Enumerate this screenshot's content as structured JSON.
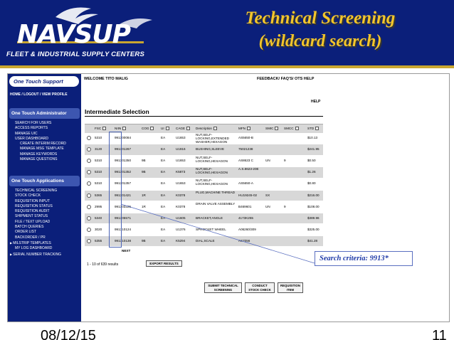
{
  "header": {
    "logo": "NAVSUP",
    "org": "FLEET & INDUSTRIAL SUPPLY CENTERS",
    "title_line1": "Technical Screening",
    "title_line2": "(wildcard search)",
    "colors": {
      "banner": "#0b1f7a",
      "title": "#f3c52a",
      "stripe": "#c9a630"
    }
  },
  "nav": {
    "brand": "One Touch Support",
    "home_links": "HOME / LOGOUT / VIEW PROFILE",
    "admin_title": "One Touch Administrator",
    "admin_items": [
      {
        "label": "SEARCH FOR USERS",
        "sub": false
      },
      {
        "label": "ACCESS REPORTS",
        "sub": false
      },
      {
        "label": "MANAGE UIC",
        "sub": false
      },
      {
        "label": "USER DASHBOARD",
        "sub": false
      },
      {
        "label": "CREATE INTERIM RECORD",
        "sub": true
      },
      {
        "label": "MANAGE MSG TEMPLATE",
        "sub": true
      },
      {
        "label": "MANAGE KEYWORDS",
        "sub": true
      },
      {
        "label": "MANAGE QUESTIONS",
        "sub": true
      }
    ],
    "apps_title": "One Touch Applications",
    "app_items": [
      {
        "label": "TECHNICAL SCREENING",
        "arrow": false
      },
      {
        "label": "STOCK CHECK",
        "arrow": false
      },
      {
        "label": "REQUISITION INPUT",
        "arrow": false
      },
      {
        "label": "REQUISITION STATUS",
        "arrow": false
      },
      {
        "label": "REQUISITION AUDIT",
        "arrow": false
      },
      {
        "label": "SHIPMENT STATUS",
        "arrow": false
      },
      {
        "label": "FILE / TEXT UPLOAD",
        "arrow": false
      },
      {
        "label": "BATCH QUERIES",
        "arrow": false
      },
      {
        "label": "ORDER LIST",
        "arrow": false
      },
      {
        "label": "BACKORDER / PR",
        "arrow": false
      },
      {
        "label": "MILSTRIP TEMPLATES",
        "arrow": true
      },
      {
        "label": "MY LOG DASHBOARD",
        "arrow": false
      },
      {
        "label": "SERIAL NUMBER TRACKING",
        "arrow": true
      }
    ]
  },
  "main": {
    "welcome": "WELCOME TITO MALIG",
    "feedback": "FEEDBACK/ FAQ'S/ OTS HELP",
    "help": "HELP",
    "section_title": "Intermediate Selection",
    "columns": [
      "FSC",
      "NIIN",
      "COG",
      "UI",
      "CAGE",
      "Description",
      "MFN",
      "SMIC",
      "SMCC",
      "STD"
    ],
    "rows": [
      [
        "5310",
        "991300084",
        "",
        "EA",
        "U1653",
        "NUT,SELF-LOCKING,EXTENDED WASHER,HEXAGON",
        "AS5650-B",
        "",
        "",
        "$10.13"
      ],
      [
        "3120",
        "991301267",
        "",
        "EA",
        "U1916",
        "BUSHING,SLEEVE",
        "75021238",
        "",
        "",
        "$241.95"
      ],
      [
        "5310",
        "991301350",
        "9B",
        "EA",
        "U1653",
        "NUT,SELF-LOCKING,HEXAGON",
        "AS8623 C",
        "UN",
        "9",
        "$0.50"
      ],
      [
        "5310",
        "991301352",
        "9B",
        "EA",
        "K5873",
        "NUT,SELF-LOCKING,HEXAGON",
        "A.S.8623-20E",
        "",
        "",
        "$1.26"
      ],
      [
        "5310",
        "991301357",
        "",
        "EA",
        "U1653",
        "NUT,SELF-LOCKING,HEXAGON",
        "AS5650-A",
        "",
        "",
        "$0.80"
      ],
      [
        "5365",
        "991301421",
        "1R",
        "EA",
        "K0378",
        "PLUG,MACHINE THREAD",
        "HU19245-02",
        "SX",
        "",
        "$216.00"
      ],
      [
        "2995",
        "991303225",
        "1R",
        "EA",
        "K0378",
        "DRAIN VALVE ASSEMBLY",
        "B469601",
        "UN",
        "9",
        "$108.00"
      ],
      [
        "5340",
        "991305571",
        "",
        "EA",
        "U1605",
        "BRACKET,ANGLE",
        "4173K255",
        "",
        "",
        "$389.96"
      ],
      [
        "3020",
        "991310124",
        "",
        "EA",
        "U1376",
        "SPROCKET WHEEL",
        "A06260/309",
        "",
        "",
        "$325.00"
      ],
      [
        "5355",
        "991310138",
        "9B",
        "EA",
        "K5294",
        "DIAL,SCALE",
        "AS7056",
        "",
        "",
        "$41.28"
      ]
    ],
    "next": "NEXT",
    "result_count": "1 - 10 of 639 results",
    "export_label": "EXPORT RESULTS",
    "btn_submit": [
      "SUBMIT TECHNICAL",
      "SCREENING"
    ],
    "btn_stock": [
      "CONDUCT",
      "STOCK CHECK"
    ],
    "btn_req": [
      "REQUISITION",
      "ITEM"
    ]
  },
  "callout": "Search criteria: 9913*",
  "footer": {
    "date": "08/12/15",
    "page": "11"
  }
}
